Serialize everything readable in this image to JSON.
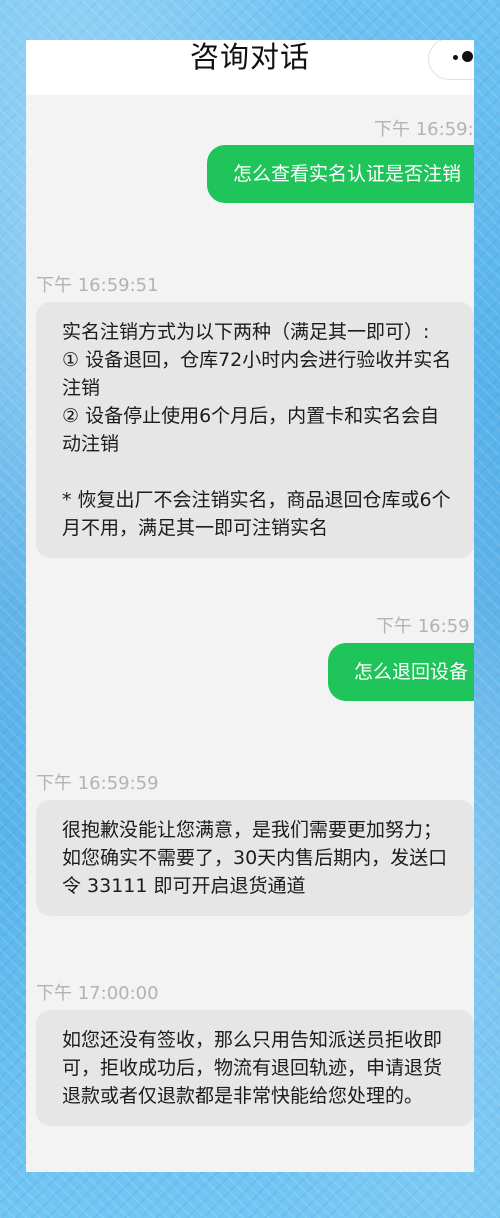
{
  "header": {
    "title": "咨询对话"
  },
  "messages": [
    {
      "side": "out",
      "time": "下午 16:59:",
      "text": "怎么查看实名认证是否注销"
    },
    {
      "side": "in",
      "time": "下午 16:59:51",
      "lines": [
        "实名注销方式为以下两种（满足其一即可）:",
        "① 设备退回，仓库72小时内会进行验收并实名注销",
        "② 设备停止使用6个月后，内置卡和实名会自动注销"
      ],
      "note": "* 恢复出厂不会注销实名，商品退回仓库或6个月不用，满足其一即可注销实名"
    },
    {
      "side": "out",
      "time": "下午 16:59",
      "text": "怎么退回设备"
    },
    {
      "side": "in",
      "time": "下午 16:59:59",
      "text": "很抱歉没能让您满意，是我们需要更加努力；如您确实不需要了，30天内售后期内，发送口令 33111 即可开启退货通道"
    },
    {
      "side": "in",
      "time": "下午 17:00:00",
      "text": "如您还没有签收，那么只用告知派送员拒收即可，拒收成功后，物流有退回轨迹，申请退货退款或者仅退款都是非常快能给您处理的。"
    }
  ],
  "colors": {
    "outgoing_bubble": "#1fc45a",
    "incoming_bubble": "#e6e6e6",
    "timestamp": "#b3b3b3"
  }
}
